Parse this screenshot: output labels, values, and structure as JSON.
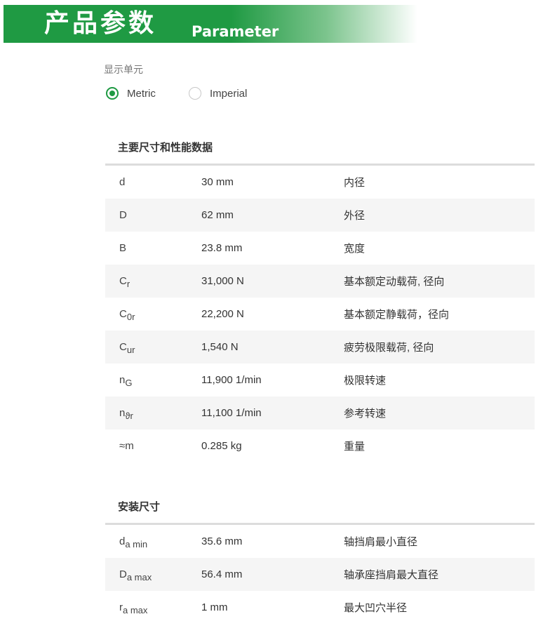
{
  "header": {
    "title": "产品参数",
    "subtitle": "Parameter"
  },
  "units": {
    "label": "显示单元",
    "options": [
      "Metric",
      "Imperial"
    ],
    "selected": "Metric"
  },
  "sections": [
    {
      "title": "主要尺寸和性能数据",
      "rows": [
        {
          "sym": "d",
          "sub": "",
          "value": "30 mm",
          "desc": "内径"
        },
        {
          "sym": "D",
          "sub": "",
          "value": "62 mm",
          "desc": "外径"
        },
        {
          "sym": "B",
          "sub": "",
          "value": "23.8 mm",
          "desc": "宽度"
        },
        {
          "sym": "C",
          "sub": "r",
          "value": "31,000 N",
          "desc": "基本额定动载荷, 径向"
        },
        {
          "sym": "C",
          "sub": "0r",
          "value": "22,200 N",
          "desc": "基本额定静载荷，径向"
        },
        {
          "sym": "C",
          "sub": "ur",
          "value": "1,540 N",
          "desc": "疲劳极限载荷, 径向"
        },
        {
          "sym": "n",
          "sub": "G",
          "value": "11,900 1/min",
          "desc": "极限转速"
        },
        {
          "sym": "n",
          "sub": "ϑr",
          "value": "11,100 1/min",
          "desc": "参考转速"
        },
        {
          "sym": "≈m",
          "sub": "",
          "value": "0.285 kg",
          "desc": "重量"
        }
      ]
    },
    {
      "title": "安装尺寸",
      "rows": [
        {
          "sym": "d",
          "sub": "a min",
          "value": "35.6 mm",
          "desc": "轴挡肩最小直径"
        },
        {
          "sym": "D",
          "sub": "a max",
          "value": "56.4 mm",
          "desc": "轴承座挡肩最大直径"
        },
        {
          "sym": "r",
          "sub": "a max",
          "value": "1 mm",
          "desc": "最大凹穴半径"
        }
      ]
    }
  ],
  "colors": {
    "accent": "#1f9a43",
    "stripe": "#f5f5f5",
    "rule": "#dcdcdc"
  }
}
